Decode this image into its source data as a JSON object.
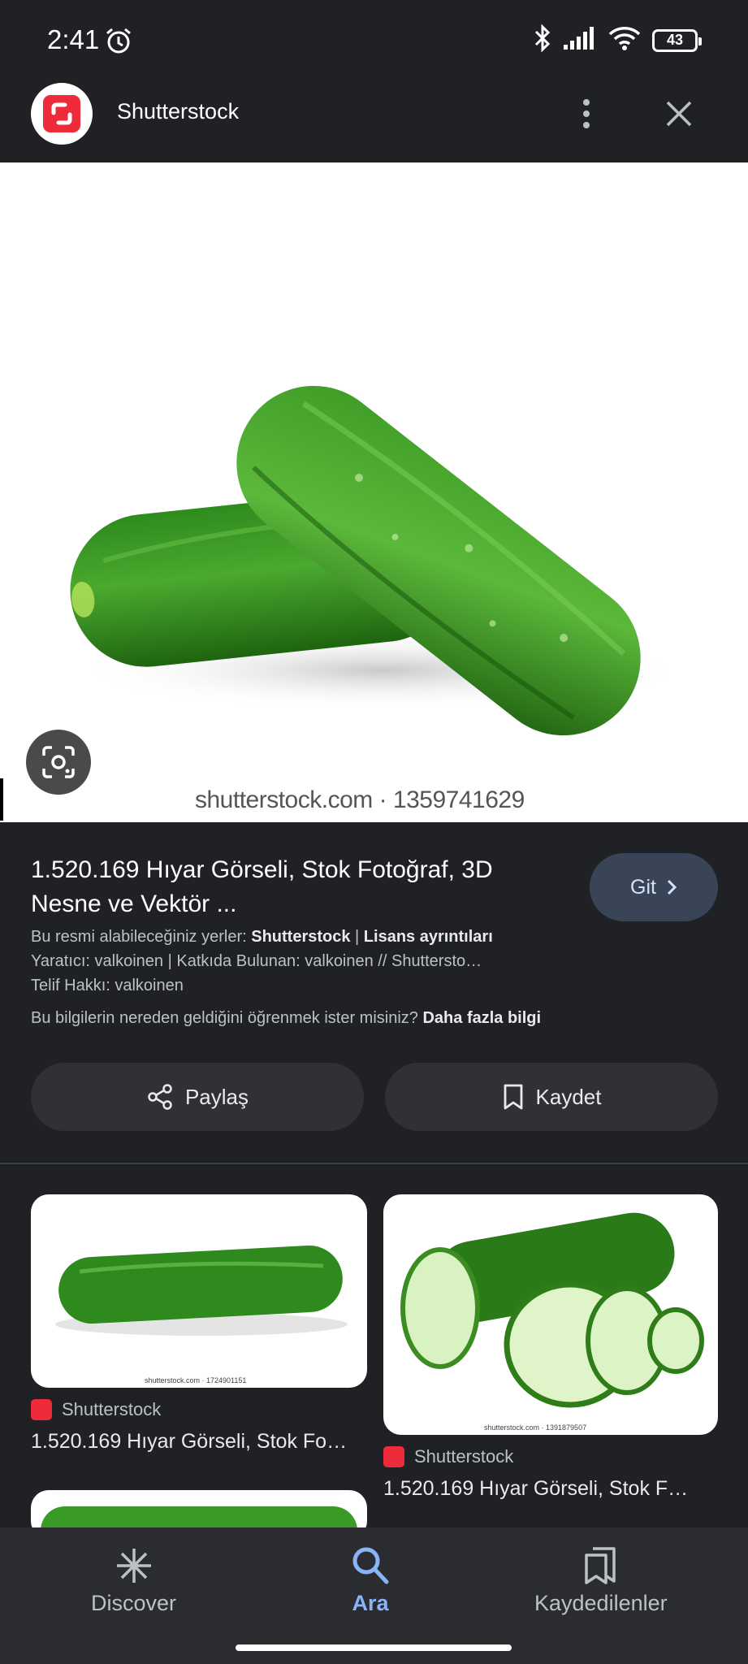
{
  "status_bar": {
    "time": "2:41",
    "battery": "43"
  },
  "header": {
    "title": "Shutterstock"
  },
  "hero": {
    "watermark": "shutterstock.com · 1359741629"
  },
  "result": {
    "title": "1.520.169 Hıyar Görseli, Stok Fotoğraf, 3D Nesne ve Vektör ...",
    "go_label": "Git",
    "available_prefix": "Bu resmi alabileceğiniz yerler: ",
    "available_source": "Shutterstock",
    "available_sep": " | ",
    "license_link": "Lisans ayrıntıları",
    "creator_line": "Yaratıcı: valkoinen | Katkıda Bulunan: valkoinen // Shuttersto…",
    "copyright_line": "Telif Hakkı: valkoinen",
    "learn_prefix": "Bu bilgilerin nereden geldiğini öğrenmek ister misiniz? ",
    "learn_link": "Daha fazla bilgi"
  },
  "actions": {
    "share_label": "Paylaş",
    "save_label": "Kaydet"
  },
  "related": [
    {
      "watermark": "shutterstock.com · 1724901151",
      "source": "Shutterstock",
      "title": "1.520.169 Hıyar Görseli, Stok Fo…"
    },
    {
      "watermark": "shutterstock.com · 1391879507",
      "source": "Shutterstock",
      "title": "1.520.169 Hıyar Görseli, Stok F…"
    }
  ],
  "bottom_nav": {
    "discover": "Discover",
    "search": "Ara",
    "saved": "Kaydedilenler"
  },
  "colors": {
    "brand": "#ee2b3b",
    "accent": "#8ab4f8",
    "background": "#202124"
  }
}
